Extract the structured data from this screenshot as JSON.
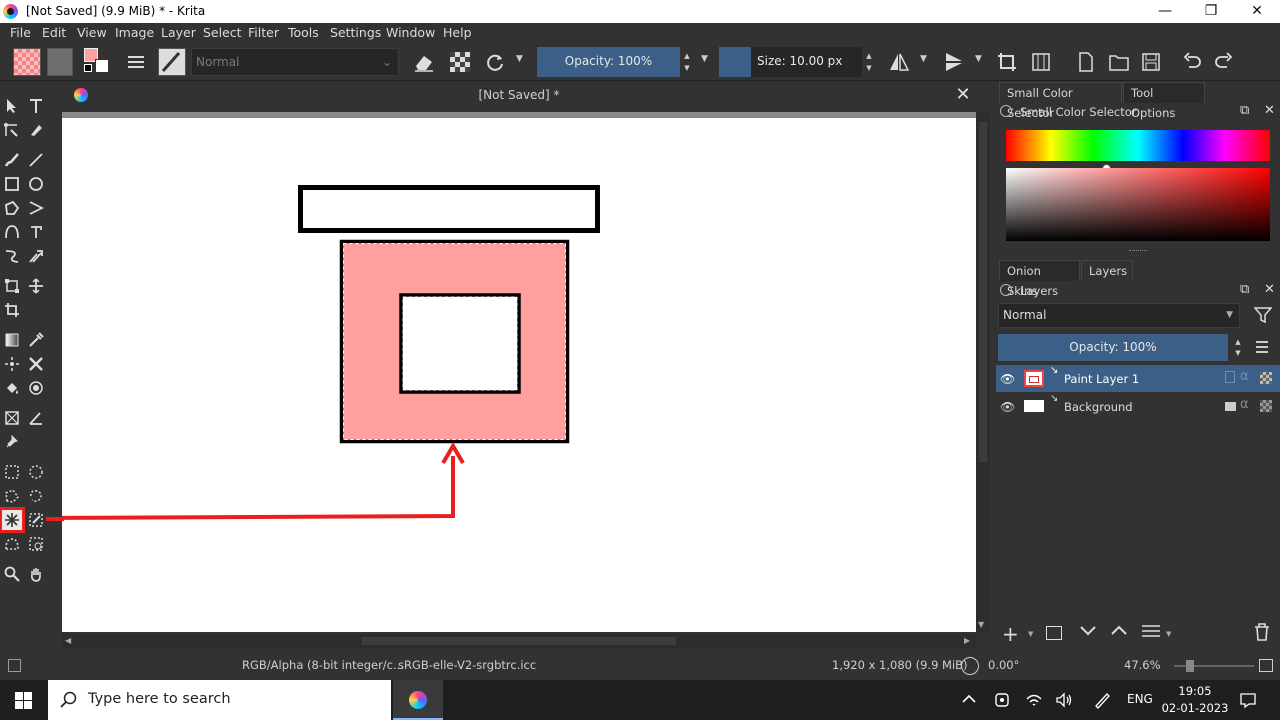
{
  "window": {
    "title": "[Not Saved]  (9.9 MiB)  * - Krita",
    "minimize": "—",
    "maximize": "❐",
    "close": "✕"
  },
  "menu": [
    "File",
    "Edit",
    "View",
    "Image",
    "Layer",
    "Select",
    "Filter",
    "Tools",
    "Settings",
    "Window",
    "Help"
  ],
  "toolbar": {
    "blend_mode": "Normal",
    "opacity": "Opacity: 100%",
    "size": "Size: 10.00 px"
  },
  "document": {
    "tab_title": "[Not Saved]  *",
    "close": "✕"
  },
  "colors": {
    "selection_fill": "#ff9f9f",
    "annotation": "#e82020",
    "fg_color": "#ff9f9f",
    "slider_blue": "#3b5f86"
  },
  "dockers": {
    "top_tabs": [
      "Small Color Selector",
      "Tool Options"
    ],
    "color_selector_title": "Small Color Selector",
    "layer_tabs": [
      "Onion Skins",
      "Layers"
    ],
    "layers_title": "Layers",
    "blend_mode": "Normal",
    "opacity": "Opacity:  100%",
    "layers": [
      {
        "name": "Paint Layer 1",
        "selected": true
      },
      {
        "name": "Background",
        "selected": false
      }
    ]
  },
  "statusbar": {
    "color_space": "RGB/Alpha (8-bit integer/c...",
    "profile": "sRGB-elle-V2-srgbtrc.icc",
    "dimensions": "1,920 x 1,080 (9.9 MiB)",
    "rotation": "0.00°",
    "zoom": "47.6%"
  },
  "taskbar": {
    "search_placeholder": "Type here to search",
    "language": "ENG",
    "time": "19:05",
    "date": "02-01-2023"
  }
}
